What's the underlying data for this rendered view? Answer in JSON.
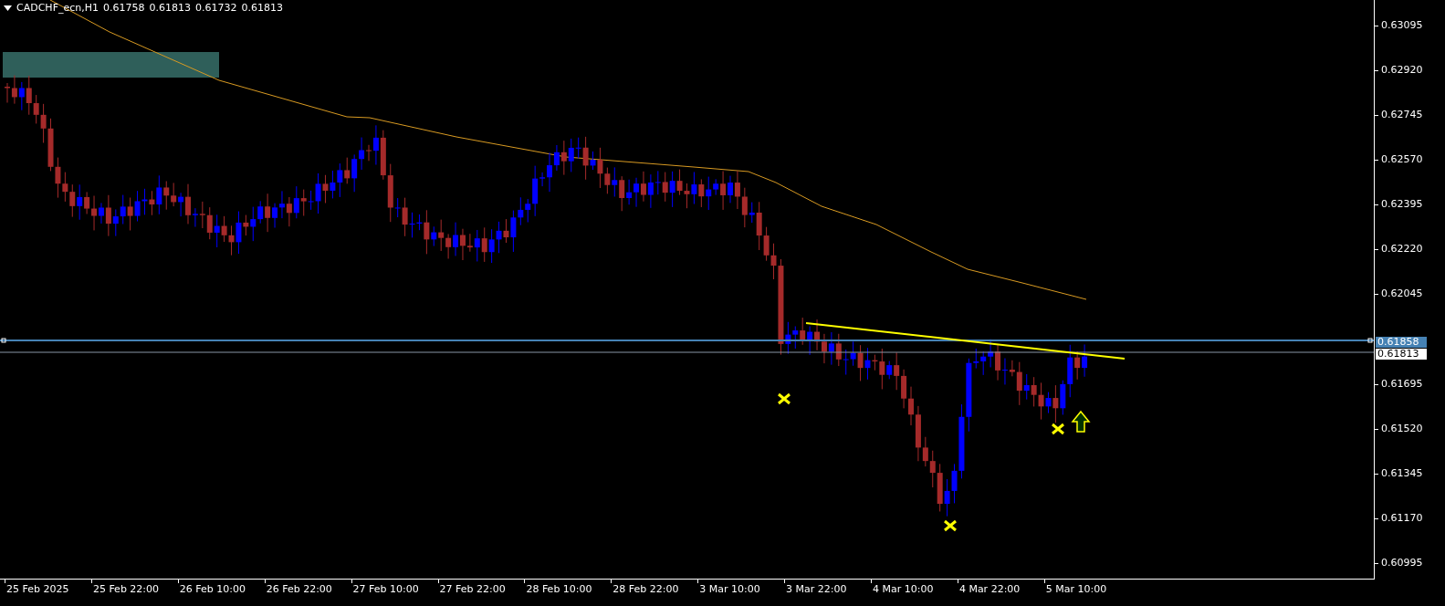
{
  "header": {
    "symbol": "CADCHF_ecn,H1",
    "quotes": [
      "0.61758",
      "0.61813",
      "0.61732",
      "0.61813"
    ]
  },
  "price_axis": {
    "labels": [
      "0.63095",
      "0.62920",
      "0.62745",
      "0.62570",
      "0.62395",
      "0.62220",
      "0.62045",
      "0.61695",
      "0.61520",
      "0.61345",
      "0.61170",
      "0.60995"
    ]
  },
  "price_tags": [
    {
      "text": "0.61858",
      "kind": "line"
    },
    {
      "text": "0.61813",
      "kind": "bid"
    }
  ],
  "time_axis": {
    "labels": [
      "25 Feb 2025",
      "25 Feb 22:00",
      "26 Feb 10:00",
      "26 Feb 22:00",
      "27 Feb 10:00",
      "27 Feb 22:00",
      "28 Feb 10:00",
      "28 Feb 22:00",
      "3 Mar 10:00",
      "3 Mar 22:00",
      "4 Mar 10:00",
      "4 Mar 22:00",
      "5 Mar 10:00"
    ]
  }
}
